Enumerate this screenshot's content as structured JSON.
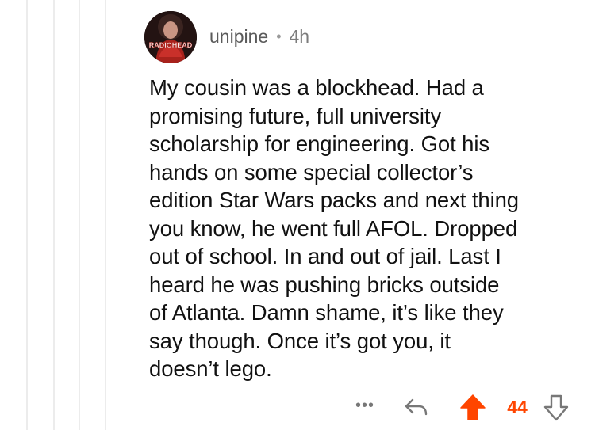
{
  "comment": {
    "username": "unipine",
    "separator": "•",
    "timestamp": "4h",
    "avatar_text": "RADIOHEAD",
    "body_lines": [
      "My cousin was a blockhead. Had a",
      "promising future, full university",
      "scholarship for engineering. Got his",
      "hands on some special collector’s",
      "edition Star Wars packs and next thing",
      "you know, he went full AFOL. Dropped",
      "out of school. In and out of jail. Last I",
      "heard he was pushing bricks outside",
      "of Atlanta. Damn shame, it’s like they",
      "say though. Once it’s got you, it",
      "doesn’t lego."
    ]
  },
  "actions": {
    "more_label": "•••",
    "vote_count": "44"
  },
  "colors": {
    "upvote": "#ff4500",
    "thread_line": "#ececec",
    "meta_text": "#7c7c7c"
  },
  "icons": {
    "more": "ellipsis-icon",
    "reply": "reply-arrow-icon",
    "upvote": "upvote-arrow-icon",
    "downvote": "downvote-arrow-icon"
  }
}
